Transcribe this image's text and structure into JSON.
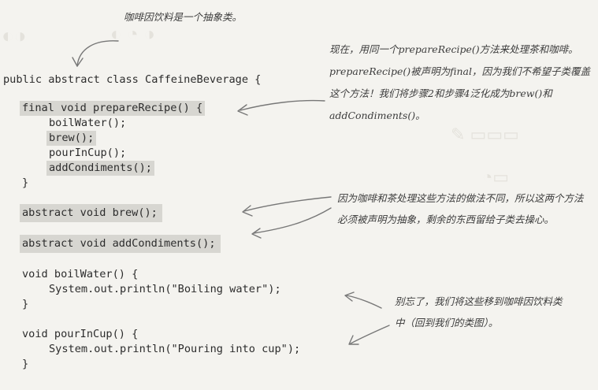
{
  "annotations": {
    "abstract_class": "咖啡因饮料是一个抽象类。",
    "prepare_recipe": "现在，用同一个prepareRecipe()方法来处理茶和咖啡。prepareRecipe()被声明为final，因为我们不希望子类覆盖这个方法！我们将步骤2和步骤4泛化成为brew()和addCondiments()。",
    "abstract_methods": "因为咖啡和茶处理这些方法的做法不同，所以这两个方法必须被声明为抽象，剩余的东西留给子类去操心。",
    "moved_methods": "别忘了，我们将这些移到咖啡因饮料类中（回到我们的类图）。"
  },
  "code": {
    "class_decl": "public abstract class CaffeineBeverage {",
    "prepare_recipe_sig": "final void prepareRecipe() {",
    "boil_water_call": "boilWater();",
    "brew_call": "brew();",
    "pour_in_cup_call": "pourInCup();",
    "add_condiments_call": "addCondiments();",
    "close_brace_1": "}",
    "abstract_brew": "abstract void brew();",
    "abstract_add_condiments": "abstract void addCondiments();",
    "boil_water_sig": "void boilWater() {",
    "boil_water_body": "System.out.println(\"Boiling water\");",
    "close_brace_2": "}",
    "pour_in_cup_sig": "void pourInCup() {",
    "pour_in_cup_body": "System.out.println(\"Pouring into cup\");",
    "close_brace_3": "}"
  }
}
